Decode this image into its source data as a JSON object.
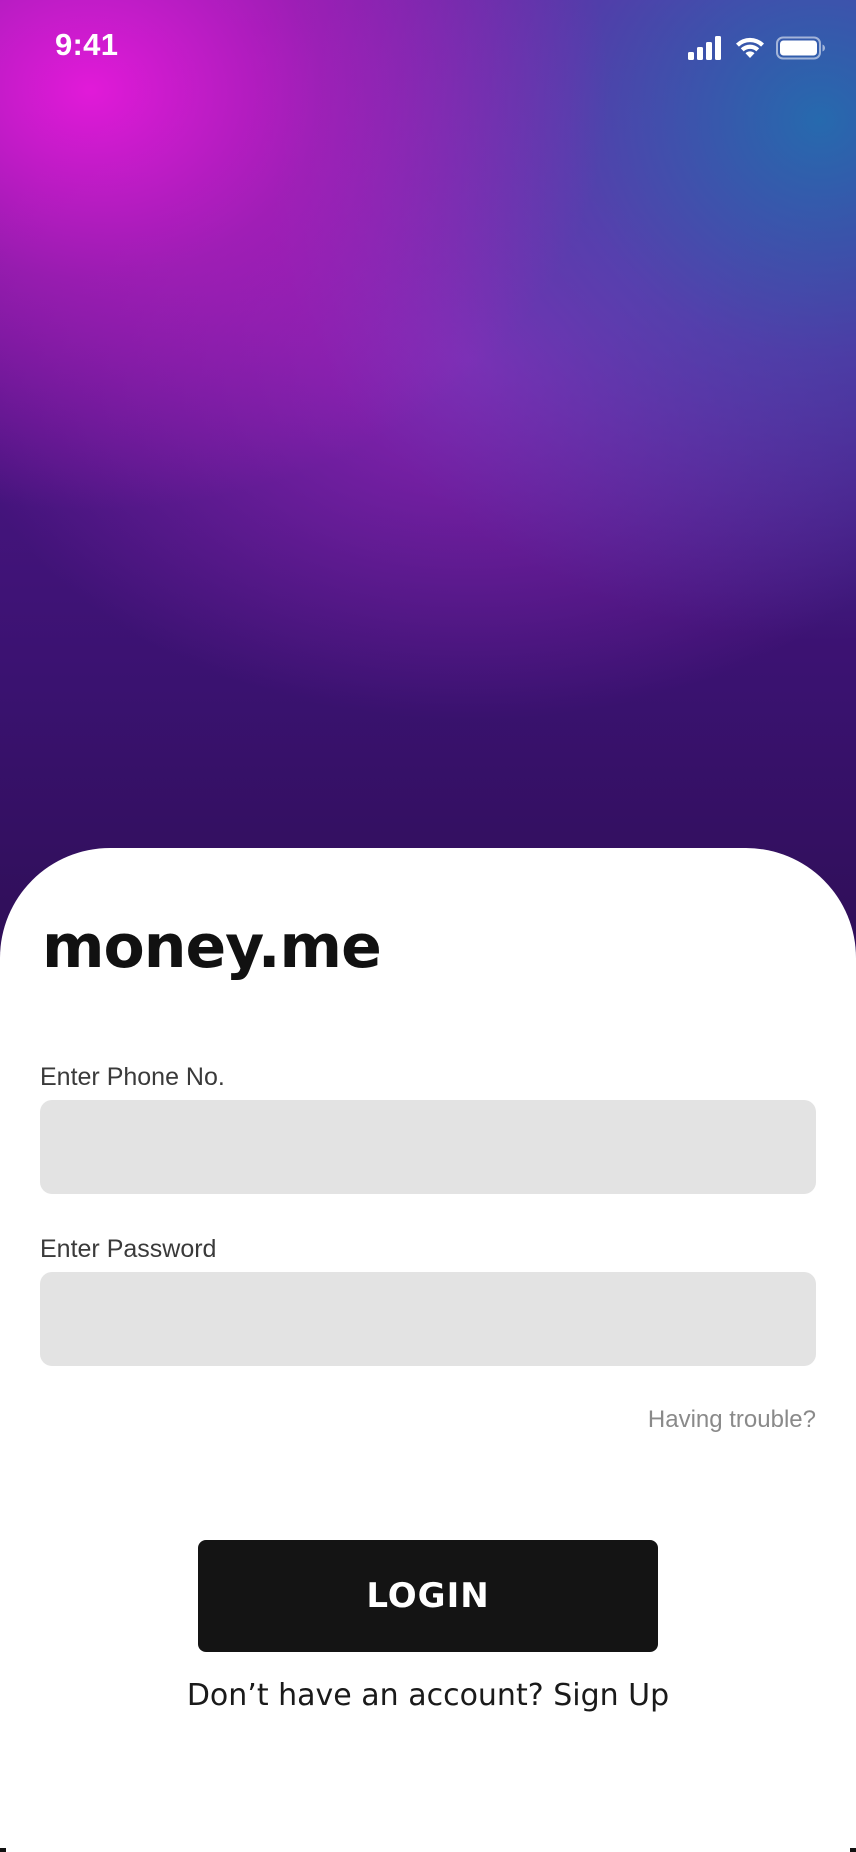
{
  "status_bar": {
    "time": "9:41",
    "icons": [
      "cellular-signal-icon",
      "wifi-icon",
      "battery-icon"
    ]
  },
  "colors": {
    "hero_magenta": "#e81adc",
    "hero_blue": "#236eaf",
    "hero_purple": "#3a1270",
    "input_background": "#e3e3e3",
    "button_background": "#141414",
    "muted_link": "#8a8a8a"
  },
  "brand": {
    "name": "money.me"
  },
  "form": {
    "phone_label": "Enter Phone No.",
    "phone_value": "",
    "password_label": "Enter Password",
    "password_value": "",
    "trouble_link": "Having trouble?"
  },
  "actions": {
    "login_label": "LOGIN",
    "signup_prompt": "Don’t have an account?",
    "signup_link": "Sign Up"
  }
}
